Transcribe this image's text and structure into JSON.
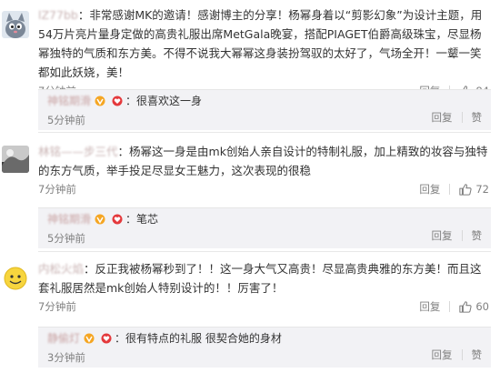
{
  "comments": [
    {
      "user": "lZ77bb",
      "text": "：非常感谢MK的邀请！感谢博主的分享！杨幂身着以“剪影幻象”为设计主题，用54万片亮片量身定做的高贵礼服出席MetGala晚宴，搭配PIAGET伯爵高级珠宝，尽显杨幂独特的气质和东方美。不得不说我大幂幂这身装扮驾驭的太好了，气场全开！一颦一笑都如此妖娆，美！",
      "time": "7分钟前",
      "reply_label": "回复",
      "likes": "84",
      "reply": {
        "user": "神铭期滑",
        "text": "：很喜欢这一身",
        "time": "5分钟前",
        "reply_label": "回复",
        "like_label": "赞"
      }
    },
    {
      "user": "林铭——步三代",
      "text": "：杨幂这一身是由mk创始人亲自设计的特制礼服，加上精致的妆容与独特的东方气质，举手投足尽显女王魅力，这次表现的很稳",
      "time": "7分钟前",
      "reply_label": "回复",
      "likes": "72",
      "reply": {
        "user": "神铭期滑",
        "text": "：笔芯",
        "time": "5分钟前",
        "reply_label": "回复",
        "like_label": "赞"
      }
    },
    {
      "user": "内松火焰",
      "text": "：反正我被杨幂秒到了！！这一身大气又高贵！尽显高贵典雅的东方美！而且这套礼服居然是mk创始人特别设计的！！厉害了！",
      "time": "7分钟前",
      "reply_label": "回复",
      "likes": "60",
      "reply": {
        "user": "静偷灯",
        "text": "：很有特点的礼服 很契合她的身材",
        "time": "3分钟前",
        "reply_label": "回复",
        "like_label": "赞"
      }
    }
  ]
}
